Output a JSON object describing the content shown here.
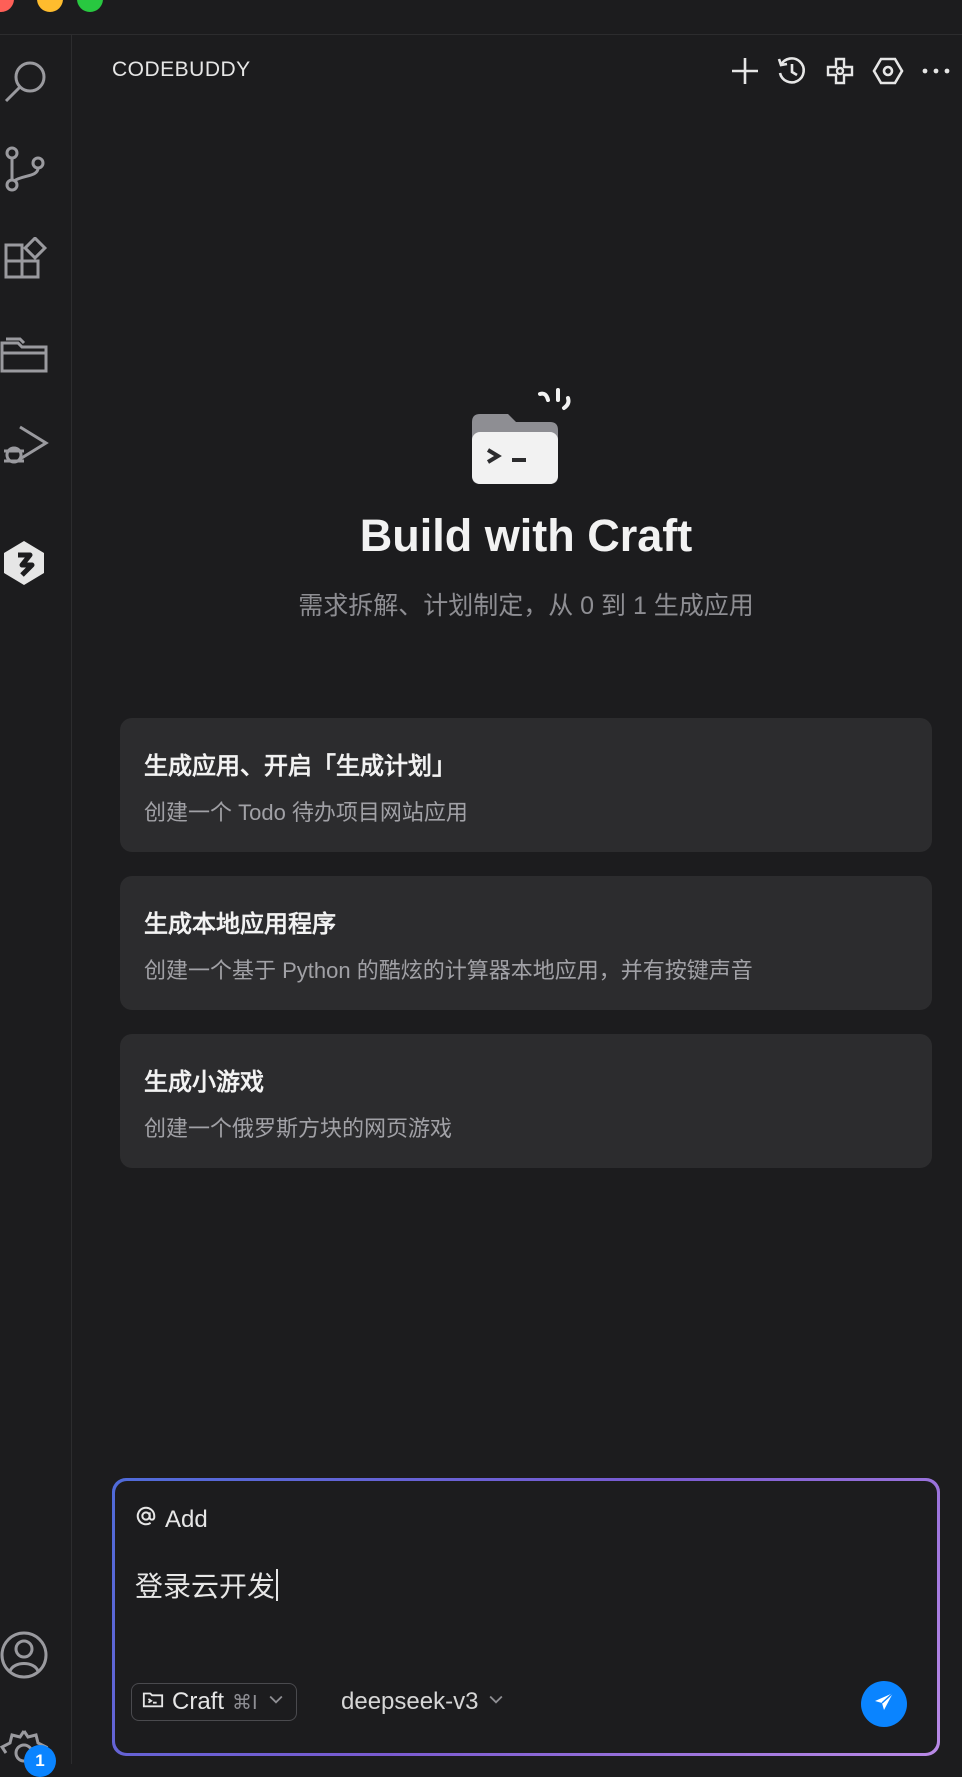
{
  "panel": {
    "title": "CODEBUDDY"
  },
  "hero": {
    "title": "Build with Craft",
    "subtitle": "需求拆解、计划制定，从 0 到 1 生成应用"
  },
  "cards": [
    {
      "title": "生成应用、开启「生成计划」",
      "desc": "创建一个 Todo 待办项目网站应用"
    },
    {
      "title": "生成本地应用程序",
      "desc": "创建一个基于 Python 的酷炫的计算器本地应用，并有按键声音"
    },
    {
      "title": "生成小游戏",
      "desc": "创建一个俄罗斯方块的网页游戏"
    }
  ],
  "input": {
    "add_label": "Add",
    "value": "登录云开发",
    "mode_label": "Craft",
    "mode_shortcut": "⌘I",
    "model_label": "deepseek-v3"
  },
  "activity": {
    "settings_badge": "1"
  },
  "colors": {
    "accent": "#0a84ff",
    "background": "#1c1c1e",
    "card": "#2c2c2e"
  }
}
